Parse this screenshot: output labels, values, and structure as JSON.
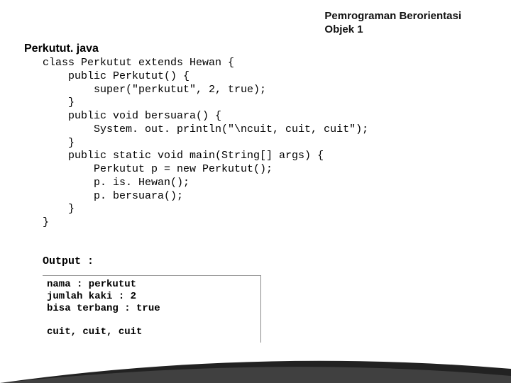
{
  "header": {
    "line1": "Pemrograman Berorientasi",
    "line2": "Objek 1"
  },
  "file_title": "Perkutut. java",
  "code": "class Perkutut extends Hewan {\n    public Perkutut() {\n        super(\"perkutut\", 2, true);\n    }\n    public void bersuara() {\n        System. out. println(\"\\ncuit, cuit, cuit\");\n    }\n    public static void main(String[] args) {\n        Perkutut p = new Perkutut();\n        p. is. Hewan();\n        p. bersuara();\n    }\n}",
  "output_label": "Output :",
  "output_text": "nama : perkutut\njumlah kaki : 2\nbisa terbang : true\n\ncuit, cuit, cuit"
}
